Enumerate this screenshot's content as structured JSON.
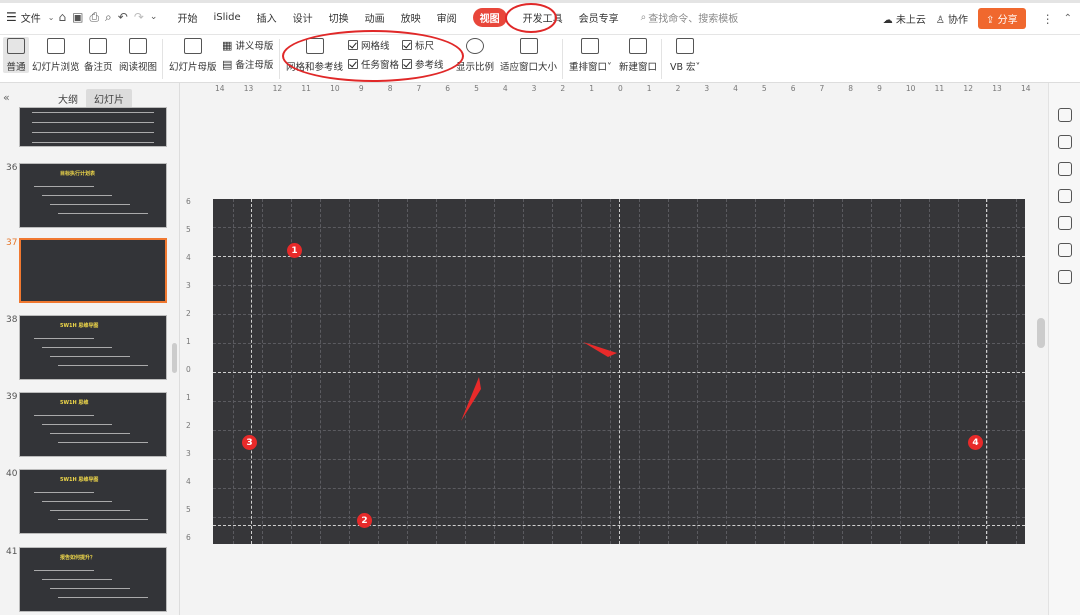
{
  "menubar": {
    "file_label": "文件",
    "tabs": [
      {
        "label": "开始",
        "active": false
      },
      {
        "label": "iSlide",
        "active": false
      },
      {
        "label": "插入",
        "active": false
      },
      {
        "label": "设计",
        "active": false
      },
      {
        "label": "切换",
        "active": false
      },
      {
        "label": "动画",
        "active": false
      },
      {
        "label": "放映",
        "active": false
      },
      {
        "label": "审阅",
        "active": false
      },
      {
        "label": "视图",
        "active": true
      },
      {
        "label": "开发工具",
        "active": false
      },
      {
        "label": "会员专享",
        "active": false
      }
    ],
    "search_placeholder": "查找命令、搜索模板",
    "cloud_label": "未上云",
    "collab_label": "协作",
    "share_label": "分享"
  },
  "ribbon": {
    "normal": "普通",
    "slide_browse": "幻灯片浏览",
    "notes_page": "备注页",
    "reading_view": "阅读视图",
    "slide_master": "幻灯片母版",
    "handout_master": "讲义母版",
    "notes_master": "备注母版",
    "grid_guides": "网格和参考线",
    "gridlines": "网格线",
    "ruler": "标尺",
    "task_pane": "任务窗格",
    "guides": "参考线",
    "zoom": "显示比例",
    "fit_window": "适应窗口大小",
    "rearrange": "重排窗口",
    "new_window": "新建窗口",
    "vb_macro": "VB 宏"
  },
  "leftpane": {
    "tab_outline": "大纲",
    "tab_slides": "幻灯片",
    "slides": [
      {
        "num": "36",
        "title": "目标执行计划表",
        "selected": false
      },
      {
        "num": "37",
        "title": "",
        "selected": true
      },
      {
        "num": "38",
        "title": "5W1H 思维导图",
        "selected": false
      },
      {
        "num": "39",
        "title": "5W1H 思维",
        "selected": false
      },
      {
        "num": "40",
        "title": "5W1H 思维导图",
        "selected": false
      },
      {
        "num": "41",
        "title": "报告如何提升？",
        "selected": false
      }
    ]
  },
  "ruler": {
    "top_labels": [
      "14",
      "13",
      "12",
      "11",
      "10",
      "9",
      "8",
      "7",
      "6",
      "5",
      "4",
      "3",
      "2",
      "1",
      "0",
      "1",
      "2",
      "3",
      "4",
      "5",
      "6",
      "7",
      "8",
      "9",
      "10",
      "11",
      "12",
      "13",
      "14"
    ],
    "left_labels": [
      "6",
      "5",
      "4",
      "3",
      "2",
      "1",
      "0",
      "1",
      "2",
      "3",
      "4",
      "5",
      "6"
    ]
  },
  "markers": [
    "1",
    "2",
    "3",
    "4"
  ],
  "colors": {
    "accent": "#e8463a",
    "share": "#f0682e",
    "canvas": "#363639",
    "marker": "#e82a2a"
  }
}
